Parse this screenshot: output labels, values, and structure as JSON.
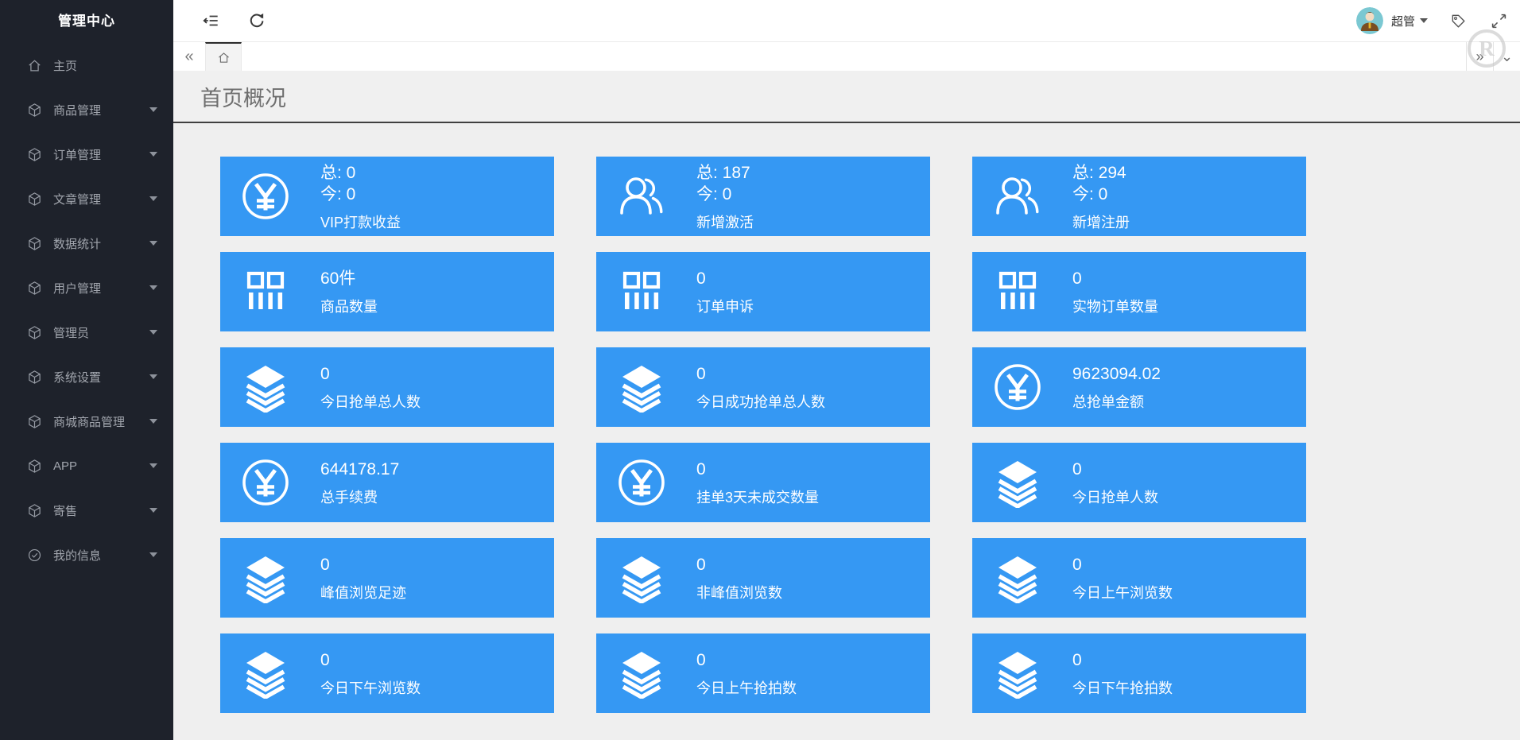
{
  "colors": {
    "card_blue": "#3598f3",
    "sidebar_bg": "#1e222b",
    "header_border": "#404040",
    "content_bg": "#efefef",
    "avatar_bg": "#7bc8d2"
  },
  "sidebar": {
    "title": "管理中心",
    "items": [
      {
        "label": "主页",
        "icon": "home-icon",
        "caret": false
      },
      {
        "label": "商品管理",
        "icon": "cube-icon",
        "caret": true
      },
      {
        "label": "订单管理",
        "icon": "cube-icon",
        "caret": true
      },
      {
        "label": "文章管理",
        "icon": "cube-icon",
        "caret": true
      },
      {
        "label": "数据统计",
        "icon": "cube-icon",
        "caret": true
      },
      {
        "label": "用户管理",
        "icon": "cube-icon",
        "caret": true
      },
      {
        "label": "管理员",
        "icon": "cube-icon",
        "caret": true
      },
      {
        "label": "系统设置",
        "icon": "cube-icon",
        "caret": true
      },
      {
        "label": "商城商品管理",
        "icon": "cube-icon",
        "caret": true
      },
      {
        "label": "APP",
        "icon": "cube-icon",
        "caret": true
      },
      {
        "label": "寄售",
        "icon": "cube-icon",
        "caret": true
      },
      {
        "label": "我的信息",
        "icon": "check-circle-icon",
        "caret": true
      }
    ]
  },
  "toolbar": {
    "left_icons": [
      "fold-menu-icon",
      "refresh-icon"
    ],
    "user_label": "超管",
    "right_icons": [
      "tag-icon",
      "fullscreen-icon"
    ],
    "watermark": "R"
  },
  "tabbar": {
    "scroll_left_glyph": "«",
    "scroll_right_glyph": "»",
    "collapse_glyph": "⌄",
    "active_tab_icon": "home-icon"
  },
  "page": {
    "title": "首页概况"
  },
  "cards": [
    {
      "icon": "yen-icon",
      "line1": "总:  0",
      "line2": "今:  0",
      "label": "VIP打款收益"
    },
    {
      "icon": "users-icon",
      "line1": "总:  187",
      "line2": "今:  0",
      "label": "新增激活"
    },
    {
      "icon": "users-icon",
      "line1": "总:  294",
      "line2": "今:  0",
      "label": "新增注册"
    },
    {
      "icon": "grid-icon",
      "line1": "60件",
      "label": "商品数量"
    },
    {
      "icon": "grid-icon",
      "line1": "0",
      "label": "订单申诉"
    },
    {
      "icon": "grid-icon",
      "line1": "0",
      "label": "实物订单数量"
    },
    {
      "icon": "layers-icon",
      "line1": "0",
      "label": "今日抢单总人数"
    },
    {
      "icon": "layers-icon",
      "line1": "0",
      "label": "今日成功抢单总人数"
    },
    {
      "icon": "yen-icon",
      "line1": "9623094.02",
      "label": "总抢单金额"
    },
    {
      "icon": "yen-icon",
      "line1": "644178.17",
      "label": "总手续费"
    },
    {
      "icon": "yen-icon",
      "line1": "0",
      "label": "挂单3天未成交数量"
    },
    {
      "icon": "layers-icon",
      "line1": "0",
      "label": "今日抢单人数"
    },
    {
      "icon": "layers-icon",
      "line1": "0",
      "label": "峰值浏览足迹"
    },
    {
      "icon": "layers-icon",
      "line1": "0",
      "label": "非峰值浏览数"
    },
    {
      "icon": "layers-icon",
      "line1": "0",
      "label": "今日上午浏览数"
    },
    {
      "icon": "layers-icon",
      "line1": "0",
      "label": "今日下午浏览数"
    },
    {
      "icon": "layers-icon",
      "line1": "0",
      "label": "今日上午抢拍数"
    },
    {
      "icon": "layers-icon",
      "line1": "0",
      "label": "今日下午抢拍数"
    }
  ]
}
